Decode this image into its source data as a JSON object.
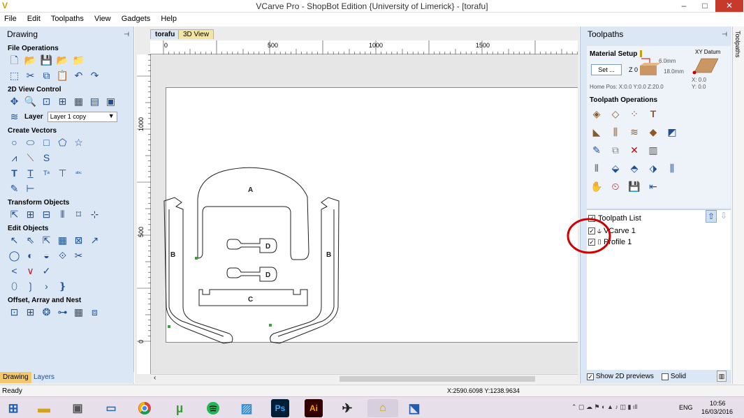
{
  "window": {
    "title": "VCarve Pro - ShopBot Edition {University of Limerick} - [torafu]",
    "minimize": "–",
    "maximize": "□",
    "close": "✕"
  },
  "menu": [
    "File",
    "Edit",
    "Toolpaths",
    "View",
    "Gadgets",
    "Help"
  ],
  "left_panel": {
    "title": "Drawing",
    "pin": "⊣",
    "sections": {
      "file_ops": "File Operations",
      "view_control": "2D View Control",
      "layer_label": "Layer",
      "layer_value": "Layer 1 copy",
      "create_vectors": "Create Vectors",
      "transform": "Transform Objects",
      "edit_objects": "Edit Objects",
      "offset": "Offset, Array and Nest"
    },
    "tabs": [
      "Drawing",
      "Layers"
    ]
  },
  "document": {
    "tabs": [
      "torafu",
      "3D View"
    ],
    "ruler_top_labels": [
      "0",
      "500",
      "1000",
      "1500"
    ],
    "ruler_left_labels": [
      "1000",
      "500",
      "0"
    ],
    "part_labels": [
      "A",
      "B",
      "B",
      "C",
      "D",
      "D"
    ]
  },
  "right_panel": {
    "title": "Toolpaths",
    "pin": "⊣",
    "strip_label": "Toolpaths",
    "material_setup": "Material Setup",
    "set_button": "Set ...",
    "z_label": "Z 0",
    "thickness_top": "6.0mm",
    "thickness_bottom": "18.0mm",
    "xy_datum": "XY Datum",
    "datum_x": "X: 0.0",
    "datum_y": "Y: 0.0",
    "home_pos": "Home Pos: X:0.0 Y:0.0 Z:20.0",
    "toolpath_operations": "Toolpath Operations",
    "toolpath_list": "Toolpath List",
    "items": [
      "VCarve 1",
      "Profile 1"
    ],
    "show_previews": "Show 2D previews",
    "solid": "Solid"
  },
  "status": {
    "left": "Ready",
    "coords": "X:2590.6098 Y:1238.9634"
  },
  "taskbar": {
    "lang": "ENG",
    "time": "10:56",
    "date": "16/03/2016",
    "apps": [
      "windows-start",
      "file-explorer",
      "control-panel",
      "file-manager",
      "chrome",
      "utorrent",
      "spotify",
      "photo-viewer",
      "photoshop",
      "illustrator",
      "cnc-app",
      "vcarve",
      "shopbot"
    ],
    "ps_label": "Ps",
    "ai_label": "Ai"
  },
  "colors": {
    "panel_bg": "#dce7f5",
    "accent_red": "#d00000",
    "taskbar_bg": "#e7e0ea"
  }
}
